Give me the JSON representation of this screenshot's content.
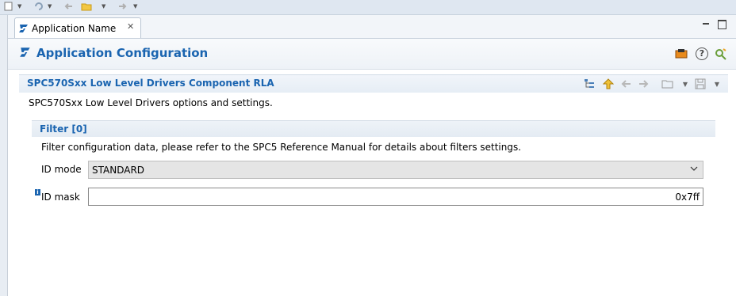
{
  "tab": {
    "title": "Application Name"
  },
  "header": {
    "title": "Application Configuration"
  },
  "section": {
    "title": "SPC570Sxx Low Level Drivers Component RLA",
    "description": "SPC570Sxx Low Level Drivers options and settings."
  },
  "filter": {
    "title": "Filter [0]",
    "description": "Filter configuration data, please refer to the SPC5 Reference Manual for details about filters settings."
  },
  "fields": {
    "id_mode": {
      "label": "ID mode",
      "value": "STANDARD"
    },
    "id_mask": {
      "label": "ID mask",
      "value": "0x7ff"
    }
  },
  "icons": {
    "toolbar": [
      "document-icon",
      "dropdown-icon",
      "refresh-icon",
      "dropdown-icon",
      "back-icon",
      "folder-open-icon",
      "dropdown-icon",
      "forward-icon",
      "dropdown-icon"
    ],
    "header_actions": [
      "generate-icon",
      "help-icon",
      "settings-icon"
    ],
    "section_actions": [
      "tree-icon",
      "up-arrow-icon",
      "back-arrow-icon",
      "forward-arrow-icon",
      "folder-icon",
      "save-icon"
    ]
  },
  "colors": {
    "accent": "#1a64b0",
    "toolbar_bg": "#dfe7f1"
  }
}
